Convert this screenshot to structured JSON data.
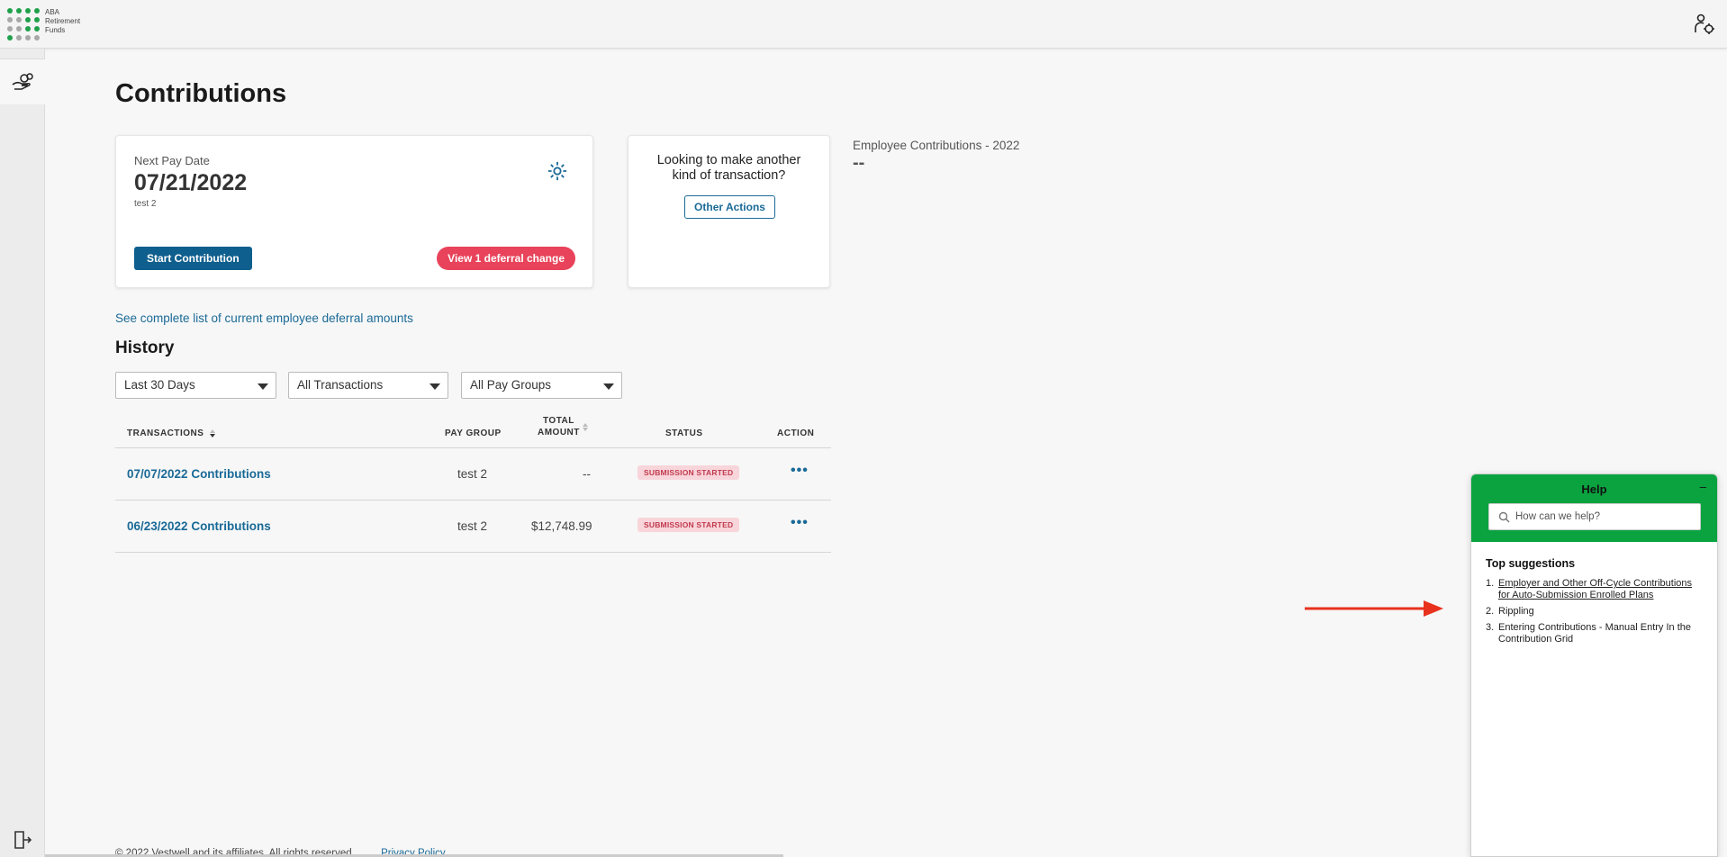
{
  "brand": {
    "logo_lines": [
      "ABA",
      "Retirement",
      "Funds"
    ],
    "dot_colors": [
      "#1fa14b",
      "#1fa14b",
      "#1fa14b",
      "#1fa14b",
      "#a8a8a8",
      "#a8a8a8",
      "#1fa14b",
      "#1fa14b",
      "#a8a8a8",
      "#a8a8a8",
      "#1fa14b",
      "#1fa14b",
      "#1fa14b",
      "#a8a8a8",
      "#a8a8a8",
      "#a8a8a8"
    ]
  },
  "page": {
    "title": "Contributions"
  },
  "pay_card": {
    "label": "Next Pay Date",
    "date": "07/21/2022",
    "pay_group": "test 2",
    "start_button": "Start Contribution",
    "deferral_button": "View 1 deferral change"
  },
  "other_card": {
    "question": "Looking to make another kind of transaction?",
    "button": "Other Actions"
  },
  "employee_contributions": {
    "label": "Employee Contributions - 2022",
    "value": "--"
  },
  "deferral_link": "See complete list of current employee deferral amounts",
  "history": {
    "title": "History",
    "filters": {
      "period": "Last 30 Days",
      "type": "All Transactions",
      "pay_group": "All Pay Groups"
    },
    "columns": {
      "transactions": "TRANSACTIONS",
      "pay_group": "PAY GROUP",
      "total_amount_line1": "TOTAL",
      "total_amount_line2": "AMOUNT",
      "status": "STATUS",
      "action": "ACTION"
    },
    "rows": [
      {
        "transaction": "07/07/2022 Contributions",
        "pay_group": "test 2",
        "amount": "--",
        "status": "SUBMISSION STARTED",
        "action": "•••"
      },
      {
        "transaction": "06/23/2022 Contributions",
        "pay_group": "test 2",
        "amount": "$12,748.99",
        "status": "SUBMISSION STARTED",
        "action": "•••"
      }
    ]
  },
  "footer": {
    "copyright": "© 2022 Vestwell and its affiliates. All rights reserved.",
    "privacy": "Privacy Policy"
  },
  "help": {
    "title": "Help",
    "minimize": "–",
    "search_placeholder": "How can we help?",
    "suggestions_title": "Top suggestions",
    "suggestions": [
      {
        "num": "1.",
        "text": "Employer and Other Off-Cycle Contributions for Auto-Submission Enrolled Plans"
      },
      {
        "num": "2.",
        "text": "Rippling"
      },
      {
        "num": "3.",
        "text": "Entering Contributions - Manual Entry In the Contribution Grid"
      }
    ]
  },
  "colors": {
    "primary": "#0f5f8e",
    "link": "#1a6a97",
    "alert": "#e8435a",
    "help_green": "#0aa33f",
    "annotation_arrow": "#e8321e"
  },
  "icons": {
    "user": "user-settings-icon",
    "nav": "hand-coins-icon",
    "gear": "gear-icon",
    "logout": "logout-icon",
    "search": "search-icon",
    "arrow": "annotation-arrow"
  }
}
